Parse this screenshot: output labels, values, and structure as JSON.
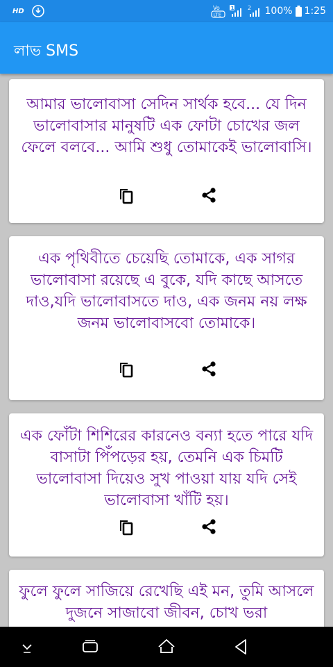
{
  "status_bar": {
    "hd": "HD",
    "volte_label": "Vo LTE",
    "sim1": "1",
    "sim2": "2",
    "battery": "100%",
    "time": "1:25"
  },
  "app_bar": {
    "title": "লাভ SMS"
  },
  "cards": [
    {
      "text": "আমার ভালোবাসা সেদিন সার্থক হবে... যে দিন ভালোবাসার মানুষটি এক ফোটা চোখের জল ফেলে বলবে... আমি শুধু তোমাকেই ভালোবাসি।",
      "copy_icon": "copy-icon",
      "share_icon": "share-icon"
    },
    {
      "text": "এক পৃথিবীতে চেয়েছি তোমাকে, এক সাগর ভালোবাসা রয়েছে এ বুকে, যদি কাছে আসতে দাও,যদি ভালোবাসতে দাও, এক জনম নয় লক্ষ জনম ভালোবাসবো তোমাকে।",
      "copy_icon": "copy-icon",
      "share_icon": "share-icon"
    },
    {
      "text": "এক ফোঁটা শিশিরের কারনেও বন্যা হতে পারে যদি বাসাটা পিঁপড়ের হয়, তেমনি এক চিমটি ভালোবাসা দিয়েও সুখ পাওয়া যায় যদি সেই ভালোবাসা খাঁটি হয়।",
      "copy_icon": "copy-icon",
      "share_icon": "share-icon"
    },
    {
      "text": "ফুলে ফুলে সাজিয়ে রেখেছি এই মন, তুমি আসলে দুজনে সাজাবো জীবন, চোখ ভরা",
      "copy_icon": "copy-icon",
      "share_icon": "share-icon"
    }
  ],
  "colors": {
    "app_bar": "#2196f3",
    "status_bar": "#1e88e5",
    "text": "#6a1b9a",
    "background": "#c6c6c6"
  },
  "nav": {
    "icons": [
      "expand-icon",
      "recents-icon",
      "home-icon",
      "back-icon"
    ]
  }
}
